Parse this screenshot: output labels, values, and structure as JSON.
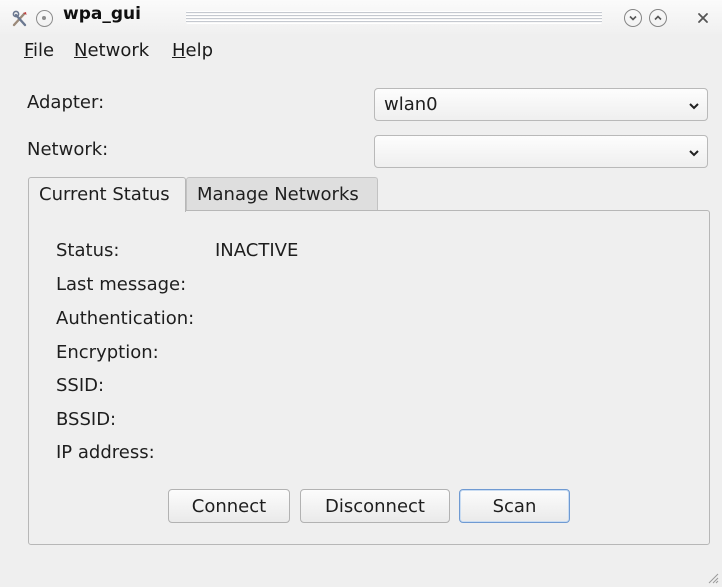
{
  "window": {
    "title": "wpa_gui",
    "icons": [
      "app-tools-icon",
      "sticky-icon",
      "minimize-icon",
      "maximize-icon",
      "close-icon"
    ]
  },
  "menubar": {
    "items": [
      {
        "mnemonic": "F",
        "rest": "ile"
      },
      {
        "mnemonic": "N",
        "rest": "etwork"
      },
      {
        "mnemonic": "H",
        "rest": "elp"
      }
    ]
  },
  "form": {
    "adapter_label": "Adapter:",
    "adapter_value": "wlan0",
    "network_label": "Network:",
    "network_value": ""
  },
  "tabs": [
    {
      "label": "Current Status",
      "active": true
    },
    {
      "label": "Manage Networks",
      "active": false
    }
  ],
  "status": {
    "fields": [
      {
        "label": "Status:",
        "value": "INACTIVE"
      },
      {
        "label": "Last message:",
        "value": ""
      },
      {
        "label": "Authentication:",
        "value": ""
      },
      {
        "label": "Encryption:",
        "value": ""
      },
      {
        "label": "SSID:",
        "value": ""
      },
      {
        "label": "BSSID:",
        "value": ""
      },
      {
        "label": "IP address:",
        "value": ""
      }
    ]
  },
  "buttons": {
    "connect": "Connect",
    "disconnect": "Disconnect",
    "scan": "Scan"
  },
  "colors": {
    "window_bg": "#efefef",
    "focus_border": "#6f9ad2"
  }
}
